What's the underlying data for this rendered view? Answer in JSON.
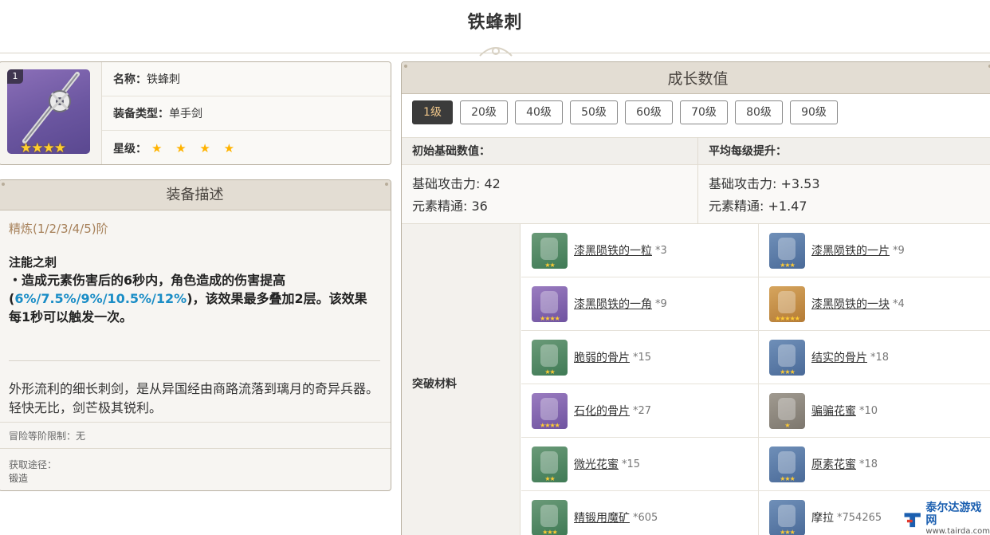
{
  "page": {
    "title": "铁蜂刺"
  },
  "info": {
    "badge": "1",
    "rows": [
      {
        "key": "名称：",
        "value": "铁蜂刺"
      },
      {
        "key": "装备类型：",
        "value": "单手剑"
      },
      {
        "key": "星级：",
        "value": "★ ★ ★ ★"
      }
    ],
    "icon_stars": "★★★★",
    "rarity": 4
  },
  "description": {
    "header": "装备描述",
    "refine": "精炼(1/2/3/4/5)阶",
    "skill_name": "注能之刺",
    "skill_prefix": "・造成元素伤害后的6秒内，角色造成的伤害提高(",
    "skill_values": "6%/7.5%/9%/10.5%/12%",
    "skill_suffix": ")，该效果最多叠加2层。该效果每1秒可以触发一次。",
    "flavor": "外形流利的细长刺剑，是从异国经由商路流落到璃月的奇异兵器。轻快无比，剑芒极其锐利。",
    "limit": "冒险等阶限制：无",
    "source_label": "获取途径：",
    "source_value": "锻造"
  },
  "growth": {
    "header": "成长数值",
    "levels": [
      "1级",
      "20级",
      "40级",
      "50级",
      "60级",
      "70级",
      "80级",
      "90级"
    ],
    "active_level": "1级",
    "base_title": "初始基础数值：",
    "avg_title": "平均每级提升：",
    "base_stats": [
      "基础攻击力: 42",
      "元素精通: 36"
    ],
    "avg_stats": [
      "基础攻击力: +3.53",
      "元素精通: +1.47"
    ],
    "materials_label": "突破材料",
    "materials": [
      {
        "name": "漆黑陨铁的一粒",
        "count": "*3",
        "rarity": "r2",
        "stars": "★★"
      },
      {
        "name": "漆黑陨铁的一片",
        "count": "*9",
        "rarity": "r3",
        "stars": "★★★"
      },
      {
        "name": "漆黑陨铁的一角",
        "count": "*9",
        "rarity": "r4",
        "stars": "★★★★"
      },
      {
        "name": "漆黑陨铁的一块",
        "count": "*4",
        "rarity": "r5",
        "stars": "★★★★★"
      },
      {
        "name": "脆弱的骨片",
        "count": "*15",
        "rarity": "r2",
        "stars": "★★"
      },
      {
        "name": "结实的骨片",
        "count": "*18",
        "rarity": "r3",
        "stars": "★★★"
      },
      {
        "name": "石化的骨片",
        "count": "*27",
        "rarity": "r4",
        "stars": "★★★★"
      },
      {
        "name": "骗骗花蜜",
        "count": "*10",
        "rarity": "r1",
        "stars": "★"
      },
      {
        "name": "微光花蜜",
        "count": "*15",
        "rarity": "r2",
        "stars": "★★"
      },
      {
        "name": "原素花蜜",
        "count": "*18",
        "rarity": "r3",
        "stars": "★★★"
      },
      {
        "name": "精锻用魔矿",
        "count": "*605",
        "rarity": "r2",
        "stars": "★★★"
      },
      {
        "name": "摩拉",
        "count": "*754265",
        "rarity": "r3",
        "stars": "★★★"
      }
    ]
  },
  "watermark": {
    "cn": "泰尔达游戏网",
    "url": "www.tairda.com"
  },
  "colors": {
    "highlight": "#1a8dc6",
    "refine": "#a7815a",
    "active_tab_text": "#f1c78a"
  }
}
